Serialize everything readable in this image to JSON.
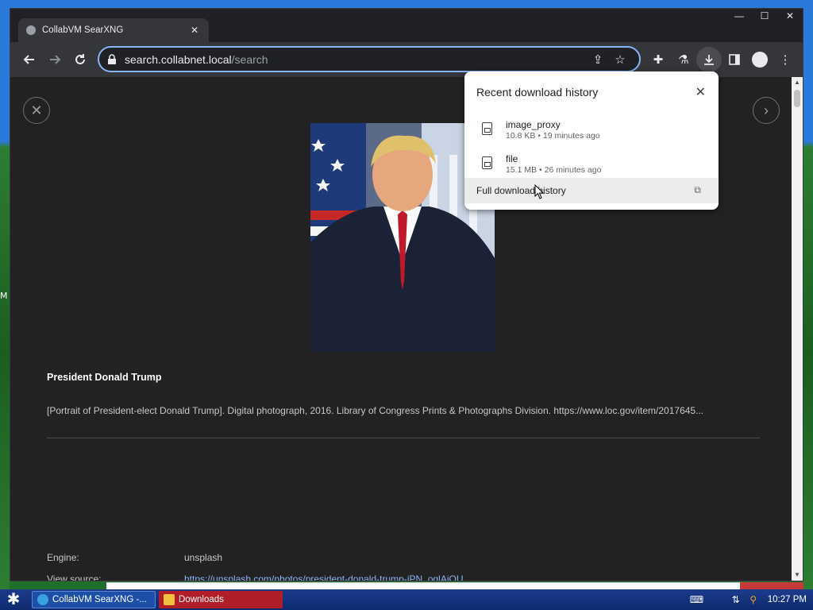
{
  "browser": {
    "tab_title": "CollabVM SearXNG",
    "url_host": "search.collabnet.local",
    "url_path": "/search"
  },
  "window_controls": {
    "minimize": "—",
    "maximize": "☐",
    "close": "✕"
  },
  "page": {
    "image_title": "President Donald Trump",
    "image_description": "[Portrait of President-elect Donald Trump]. Digital photograph, 2016. Library of Congress Prints & Photographs Division. https://www.loc.gov/item/2017645...",
    "meta": [
      {
        "label": "Engine:",
        "value": "unsplash"
      },
      {
        "label": "View source:",
        "value": "https://unsplash.com/photos/president-donald-trump-jPN_oglAjOU"
      }
    ]
  },
  "downloads": {
    "header": "Recent download history",
    "items": [
      {
        "name": "image_proxy",
        "info": "10.8 KB • 19 minutes ago"
      },
      {
        "name": "file",
        "info": "15.1 MB • 26 minutes ago"
      }
    ],
    "full_history": "Full download history"
  },
  "taskbar": {
    "items": [
      {
        "label": "CollabVM SearXNG -..."
      },
      {
        "label": "Downloads"
      }
    ],
    "clock": "10:27 PM"
  },
  "desktop": {
    "side_char": "M"
  },
  "colors": {
    "accent": "#8ab4f8",
    "page_bg": "#222222",
    "toolbar_bg": "#35363a",
    "taskbar_bg": "#0d2a6e"
  }
}
